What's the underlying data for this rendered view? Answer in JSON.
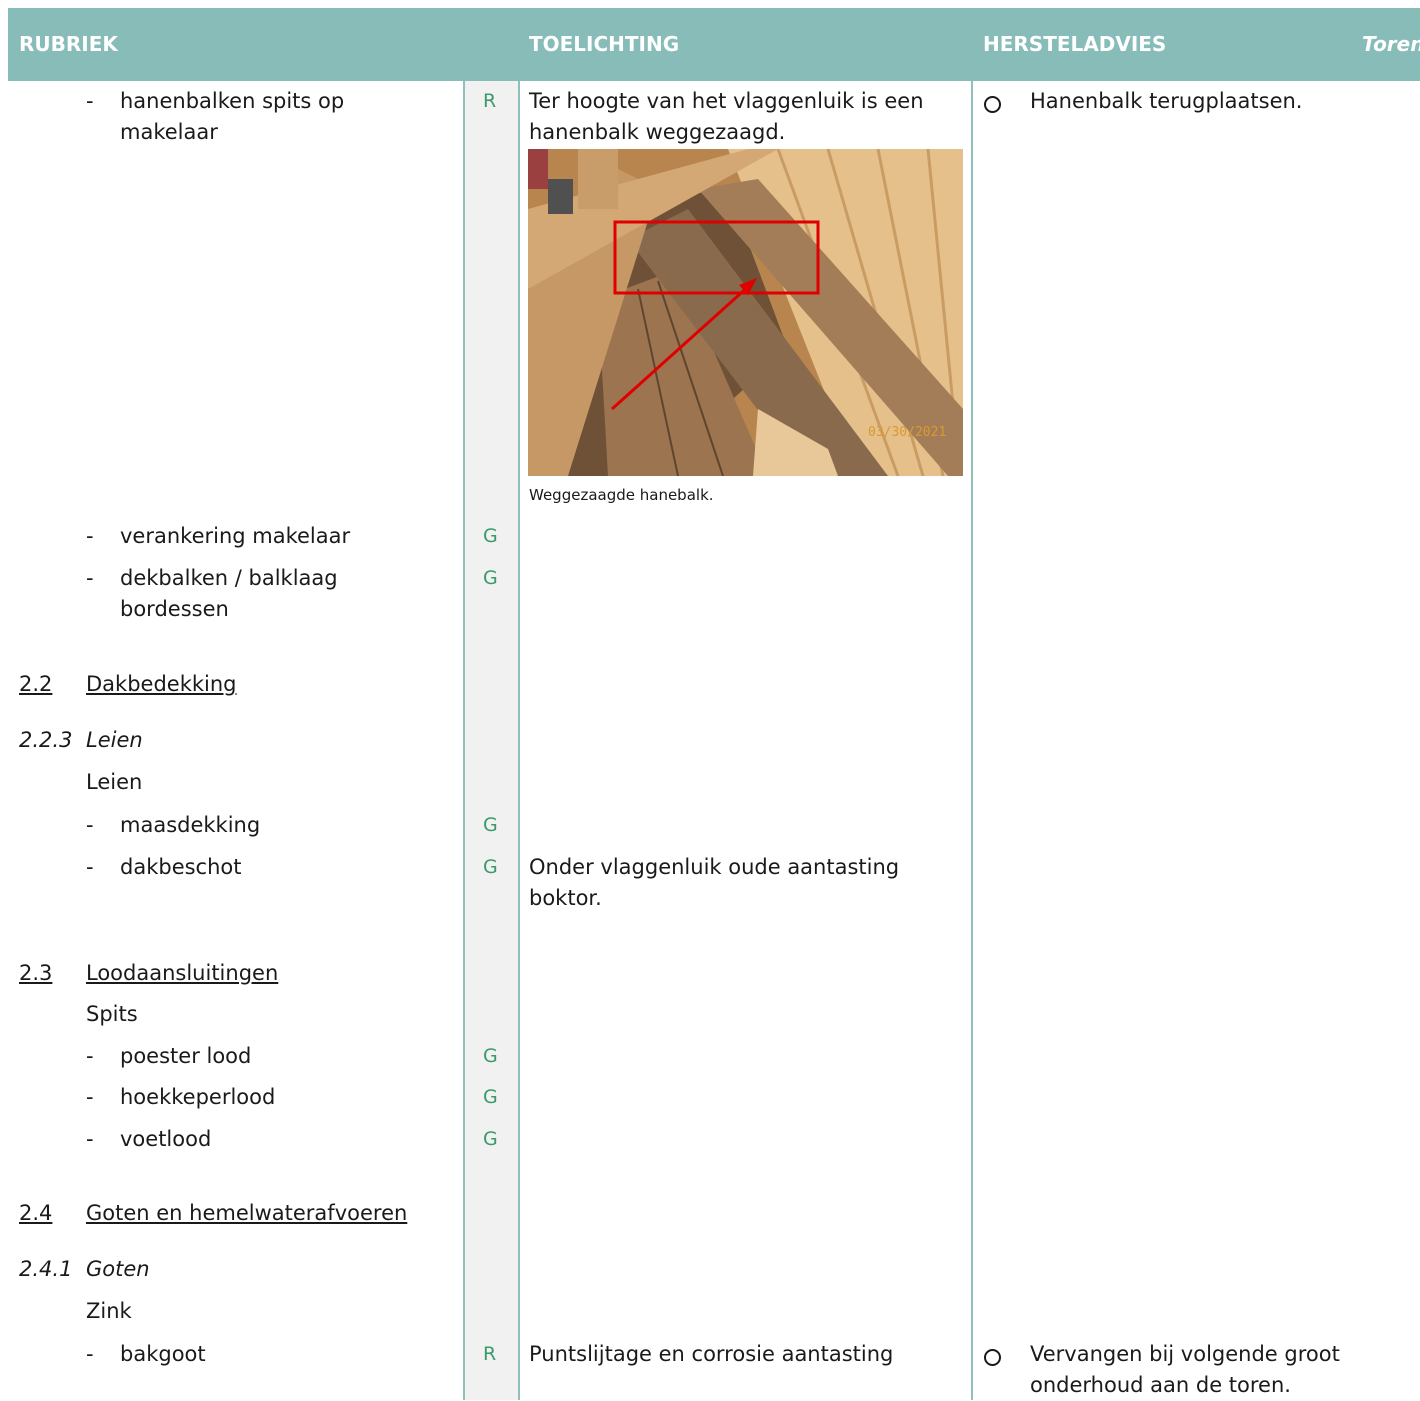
{
  "header": {
    "rubriek": "RUBRIEK",
    "toelichting": "TOELICHTING",
    "hersteladvies": "HERSTELADVIES",
    "toren": "Toren"
  },
  "items": {
    "hanenbalken_line1": "hanenbalken spits op",
    "hanenbalken_line2": "makelaar",
    "verankering": "verankering makelaar",
    "dekbalken_line1": "dekbalken / balklaag",
    "dekbalken_line2": "bordessen",
    "maasdekking": "maasdekking",
    "dakbeschot": "dakbeschot",
    "poester": "poester lood",
    "hoekkeper": "hoekkeperlood",
    "voetlood": "voetlood",
    "bakgoot": "bakgoot"
  },
  "sections": {
    "s22_num": "2.2",
    "s22_title": "Dakbedekking",
    "s223_num": "2.2.3",
    "s223_title": "Leien",
    "s223_sub": "Leien",
    "s23_num": "2.3",
    "s23_title": "Loodaansluitingen",
    "s23_sub": "Spits",
    "s24_num": "2.4",
    "s24_title": "Goten en hemelwaterafvoeren",
    "s241_num": "2.4.1",
    "s241_title": "Goten",
    "s241_sub": "Zink"
  },
  "dash": "-",
  "grades": {
    "hanenbalken": "R",
    "verankering": "G",
    "dekbalken": "G",
    "maasdekking": "G",
    "dakbeschot": "G",
    "poester": "G",
    "hoekkeper": "G",
    "voetlood": "G",
    "bakgoot": "R"
  },
  "toelichting": {
    "hanenbalk_line1": "Ter hoogte van het vlaggenluik is een",
    "hanenbalk_line2": "hanenbalk weggezaagd.",
    "photo_caption": "Weggezaagde hanebalk.",
    "photo_date": "03/30/2021",
    "dakbeschot_line1": "Onder vlaggenluik oude aantasting",
    "dakbeschot_line2": "boktor.",
    "bakgoot": "Puntslijtage en corrosie aantasting"
  },
  "herstel": {
    "hanenbalk": "Hanenbalk terugplaatsen.",
    "bakgoot_line1": "Vervangen bij volgende groot",
    "bakgoot_line2": "onderhoud aan de toren."
  },
  "colors": {
    "header_bg": "#87bcb8",
    "grade_text": "#3a9a6a",
    "column_bar": "#f1f1f1",
    "annotation_red": "#e00000"
  }
}
